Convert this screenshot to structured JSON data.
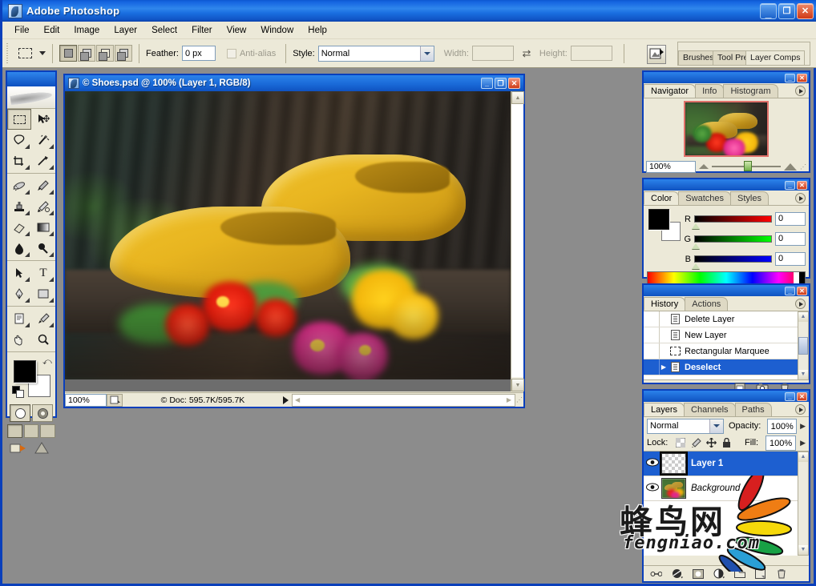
{
  "app": {
    "title": "Adobe Photoshop",
    "window_buttons": {
      "minimize": "_",
      "maximize": "❐",
      "close": "✕"
    }
  },
  "menubar": {
    "items": [
      "File",
      "Edit",
      "Image",
      "Layer",
      "Select",
      "Filter",
      "View",
      "Window",
      "Help"
    ]
  },
  "options_bar": {
    "tool_icon": "rectangular-marquee-icon",
    "selection_modes": [
      "new-selection",
      "add-to-selection",
      "subtract-from-selection",
      "intersect-with-selection"
    ],
    "feather_label": "Feather:",
    "feather_value": "0 px",
    "antialias_label": "Anti-alias",
    "antialias_checked": false,
    "style_label": "Style:",
    "style_value": "Normal",
    "width_label": "Width:",
    "width_value": "",
    "height_label": "Height:",
    "height_value": "",
    "swap_icon": "swap-dimensions-icon",
    "jump_icon": "jump-to-imageready-icon",
    "palette_well_tabs": [
      "Brushes",
      "Tool Presets",
      "Layer Comps"
    ]
  },
  "toolbox": {
    "tools": [
      {
        "name": "rectangular-marquee-tool",
        "glyph": "▭",
        "selected": true,
        "has_submenu": false
      },
      {
        "name": "move-tool",
        "glyph": "✥",
        "selected": false,
        "has_submenu": false
      },
      {
        "name": "lasso-tool",
        "glyph": "◯",
        "selected": false,
        "has_submenu": true
      },
      {
        "name": "magic-wand-tool",
        "glyph": "✳",
        "selected": false,
        "has_submenu": true
      },
      {
        "name": "crop-tool",
        "glyph": "⌗",
        "selected": false,
        "has_submenu": false
      },
      {
        "name": "slice-tool",
        "glyph": "✂",
        "selected": false,
        "has_submenu": true
      },
      {
        "name": "healing-brush-tool",
        "glyph": "✎",
        "selected": false,
        "has_submenu": true
      },
      {
        "name": "brush-tool",
        "glyph": "🖌",
        "selected": false,
        "has_submenu": true
      },
      {
        "name": "clone-stamp-tool",
        "glyph": "♜",
        "selected": false,
        "has_submenu": true
      },
      {
        "name": "history-brush-tool",
        "glyph": "✒",
        "selected": false,
        "has_submenu": true
      },
      {
        "name": "eraser-tool",
        "glyph": "▱",
        "selected": false,
        "has_submenu": true
      },
      {
        "name": "gradient-tool",
        "glyph": "▩",
        "selected": false,
        "has_submenu": true
      },
      {
        "name": "blur-tool",
        "glyph": "💧",
        "selected": false,
        "has_submenu": true
      },
      {
        "name": "dodge-tool",
        "glyph": "🔍",
        "selected": false,
        "has_submenu": true
      },
      {
        "name": "path-selection-tool",
        "glyph": "➤",
        "selected": false,
        "has_submenu": true
      },
      {
        "name": "type-tool",
        "glyph": "T",
        "selected": false,
        "has_submenu": true
      },
      {
        "name": "pen-tool",
        "glyph": "✑",
        "selected": false,
        "has_submenu": true
      },
      {
        "name": "rectangle-shape-tool",
        "glyph": "▢",
        "selected": false,
        "has_submenu": true
      },
      {
        "name": "notes-tool",
        "glyph": "🗒",
        "selected": false,
        "has_submenu": true
      },
      {
        "name": "eyedropper-tool",
        "glyph": "⌖",
        "selected": false,
        "has_submenu": true
      },
      {
        "name": "hand-tool",
        "glyph": "✋",
        "selected": false,
        "has_submenu": false
      },
      {
        "name": "zoom-tool",
        "glyph": "🔎",
        "selected": false,
        "has_submenu": false
      }
    ],
    "foreground_color": "#000000",
    "background_color": "#ffffff",
    "quick_mask_modes": [
      "standard-mode",
      "quick-mask-mode"
    ],
    "screen_modes": [
      "standard-screen-mode",
      "full-screen-with-menubar",
      "full-screen-mode"
    ],
    "jump_to_imageready": "jump-to-imageready-icon"
  },
  "document": {
    "title": "© Shoes.psd @ 100% (Layer 1, RGB/8)",
    "window_buttons": {
      "minimize": "_",
      "maximize": "❐",
      "close": "✕"
    },
    "status": {
      "zoom": "100%",
      "doc_info": "© Doc: 595.7K/595.7K",
      "thumbnail_icon": "preview-thumbnail-icon",
      "play_icon": "status-menu-arrow-icon"
    },
    "image_description": "Two yellow wooden clogs on a wooden ledge with red, pink and yellow flowers in the foreground and a blurred dark green garden background"
  },
  "navigator": {
    "tabs": [
      "Navigator",
      "Info",
      "Histogram"
    ],
    "active_tab": "Navigator",
    "zoom_value": "100%",
    "view_box_color": "#e0716a",
    "slider_position_percent": 46
  },
  "color_panel": {
    "tabs": [
      "Color",
      "Swatches",
      "Styles"
    ],
    "active_tab": "Color",
    "foreground": "#000000",
    "background": "#ffffff",
    "channels": [
      {
        "label": "R",
        "value": "0"
      },
      {
        "label": "G",
        "value": "0"
      },
      {
        "label": "B",
        "value": "0"
      }
    ]
  },
  "history_panel": {
    "tabs": [
      "History",
      "Actions"
    ],
    "active_tab": "History",
    "items": [
      {
        "label": "Delete Layer",
        "icon": "document-state-icon",
        "selected": false
      },
      {
        "label": "New Layer",
        "icon": "document-state-icon",
        "selected": false
      },
      {
        "label": "Rectangular Marquee",
        "icon": "marquee-state-icon",
        "selected": false
      },
      {
        "label": "Deselect",
        "icon": "document-state-icon",
        "selected": true
      }
    ],
    "footer_icons": [
      "new-document-from-state-icon",
      "create-snapshot-icon",
      "delete-state-icon"
    ]
  },
  "layers_panel": {
    "tabs": [
      "Layers",
      "Channels",
      "Paths"
    ],
    "active_tab": "Layers",
    "blend_mode": "Normal",
    "opacity_label": "Opacity:",
    "opacity_value": "100%",
    "lock_label": "Lock:",
    "lock_icons": [
      "lock-transparent-pixels-icon",
      "lock-image-pixels-icon",
      "lock-position-icon",
      "lock-all-icon"
    ],
    "fill_label": "Fill:",
    "fill_value": "100%",
    "layers": [
      {
        "name": "Layer 1",
        "visible": true,
        "selected": true,
        "thumbnail": "transparent-checker",
        "italic": false
      },
      {
        "name": "Background",
        "visible": true,
        "selected": false,
        "thumbnail": "photo-thumbnail",
        "italic": true
      }
    ],
    "footer_icons": [
      "link-layers-icon",
      "layer-style-icon",
      "layer-mask-icon",
      "adjustment-layer-icon",
      "new-group-icon",
      "new-layer-icon",
      "delete-layer-icon"
    ]
  },
  "watermark": {
    "chinese": "蜂鸟网",
    "latin": "fengniao.com",
    "logo": "feather-wing-logo",
    "feather_colors": [
      "#d71f1f",
      "#ef7d14",
      "#f5d80a",
      "#18a145",
      "#2a9fd6",
      "#1f4fae"
    ]
  }
}
